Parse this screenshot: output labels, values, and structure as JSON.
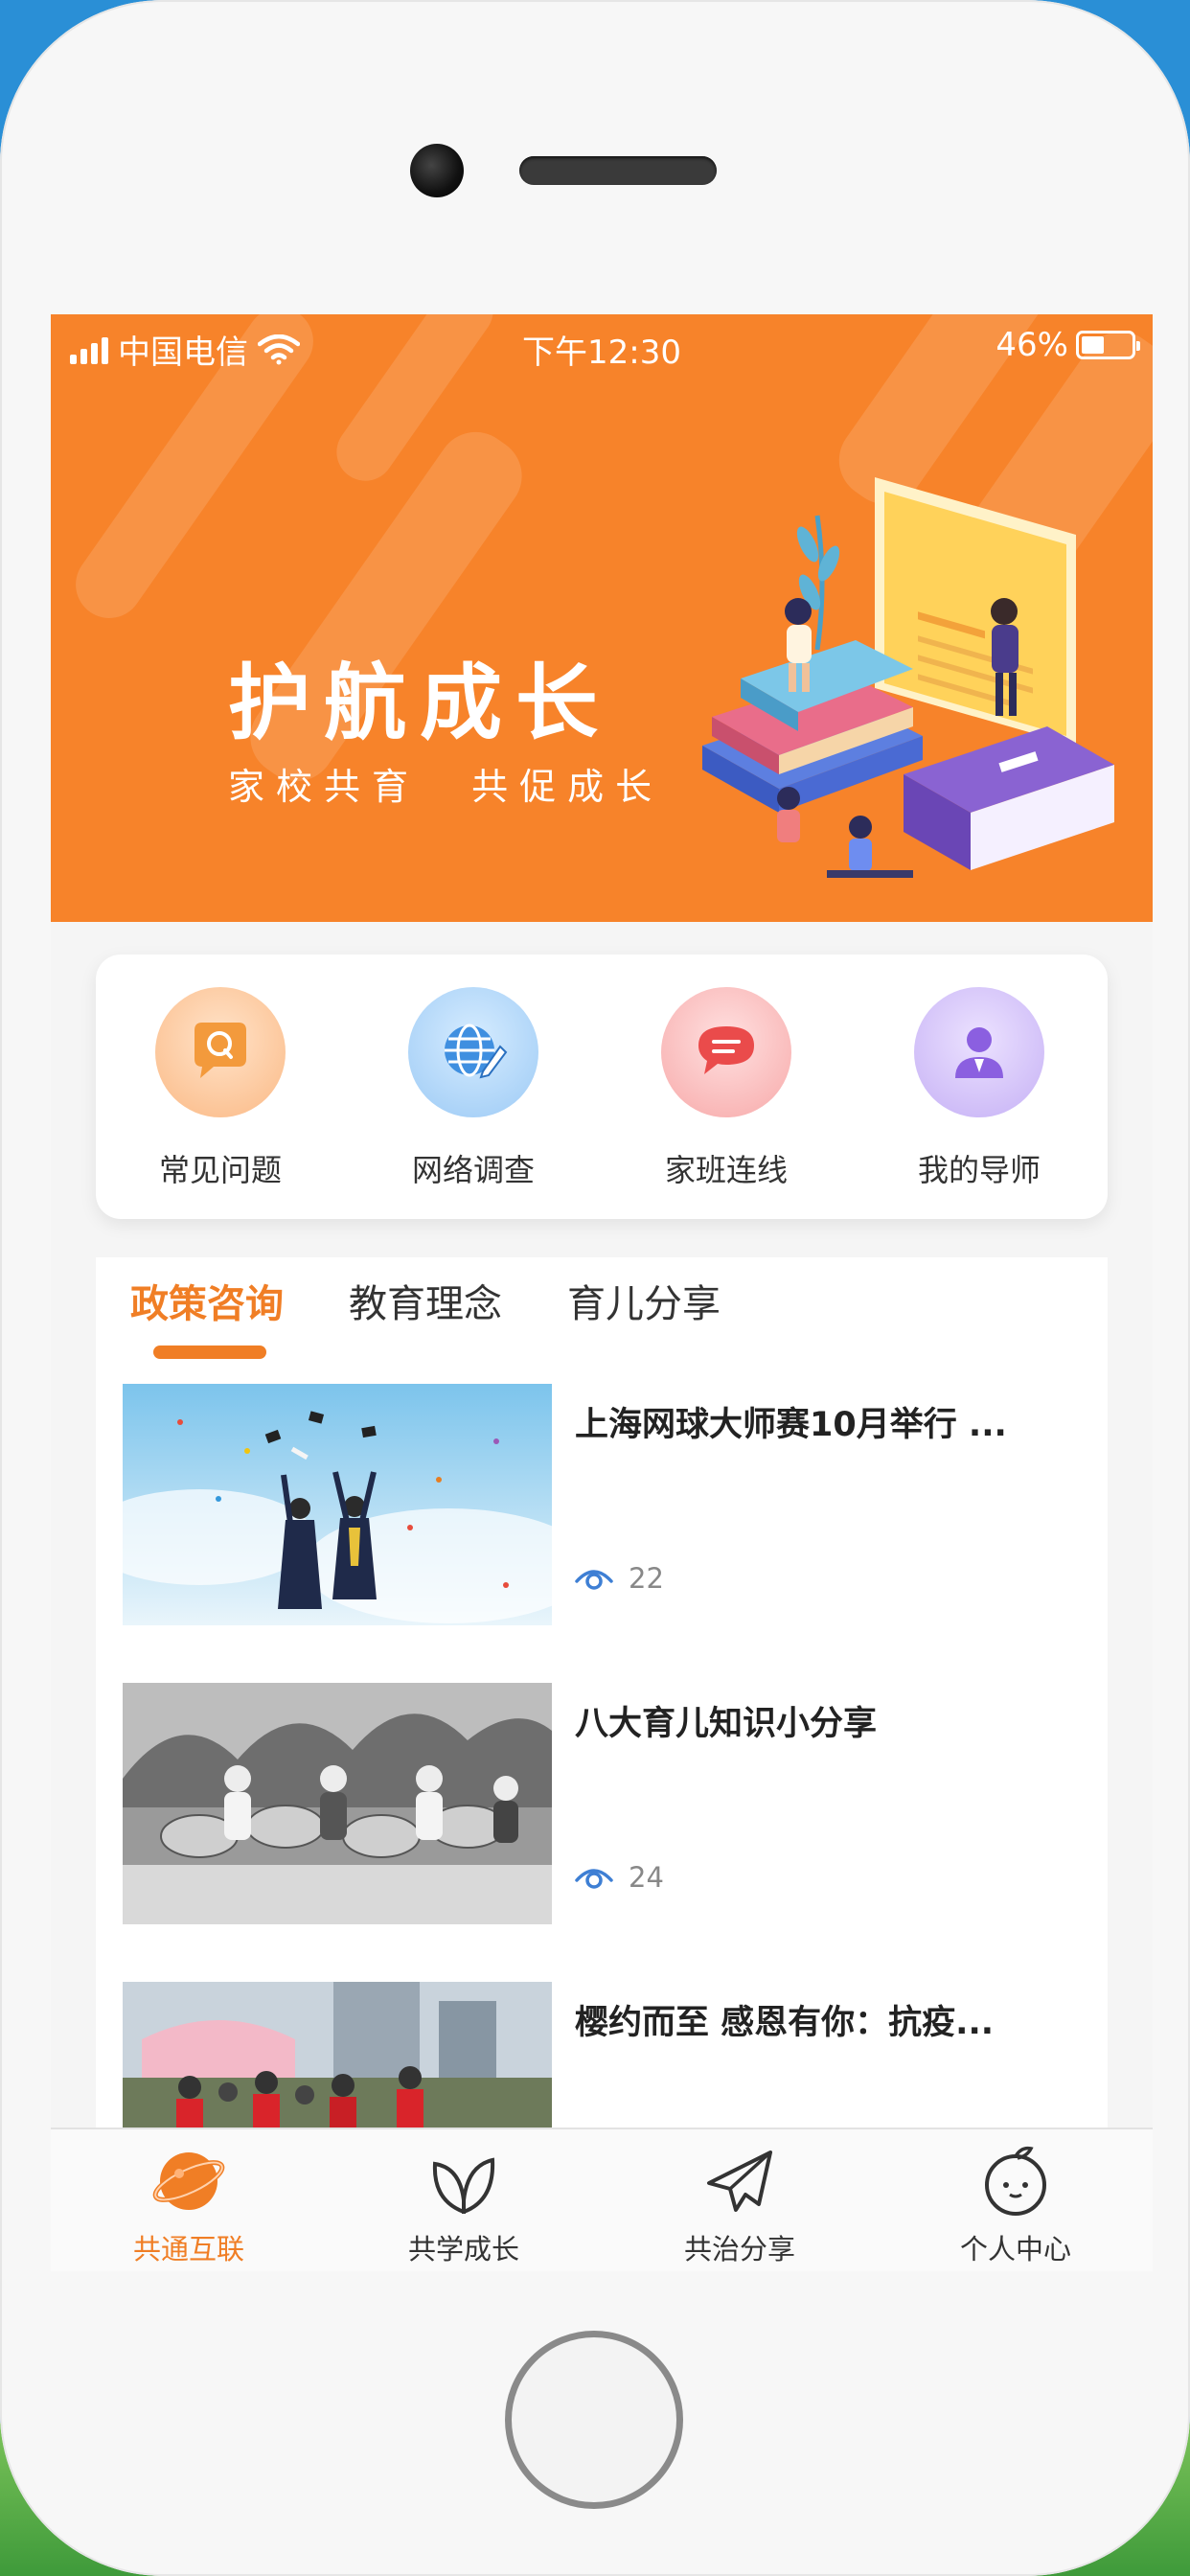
{
  "status_bar": {
    "carrier": "中国电信",
    "time": "下午12:30",
    "battery": "46%",
    "battery_level": 0.46
  },
  "banner": {
    "title": "护航成长",
    "subtitle": "家校共育   共促成长"
  },
  "quick_links": [
    {
      "label": "常见问题",
      "icon": "question-chat-icon"
    },
    {
      "label": "网络调查",
      "icon": "globe-survey-icon"
    },
    {
      "label": "家班连线",
      "icon": "message-bubble-icon"
    },
    {
      "label": "我的导师",
      "icon": "mentor-icon"
    }
  ],
  "tabs": [
    {
      "label": "政策咨询",
      "active": true
    },
    {
      "label": "教育理念",
      "active": false
    },
    {
      "label": "育儿分享",
      "active": false
    }
  ],
  "news": [
    {
      "title": "上海网球大师赛10月举行 ...",
      "views": "22"
    },
    {
      "title": "八大育儿知识小分享",
      "views": "24"
    },
    {
      "title": "樱约而至 感恩有你：抗疫...",
      "views": ""
    }
  ],
  "bottom_nav": [
    {
      "label": "共通互联",
      "icon": "planet-icon",
      "active": true
    },
    {
      "label": "共学成长",
      "icon": "leaf-icon",
      "active": false
    },
    {
      "label": "共治分享",
      "icon": "paper-plane-icon",
      "active": false
    },
    {
      "label": "个人中心",
      "icon": "orange-face-icon",
      "active": false
    }
  ],
  "colors": {
    "accent": "#f07e25",
    "banner": "#f7832a"
  }
}
